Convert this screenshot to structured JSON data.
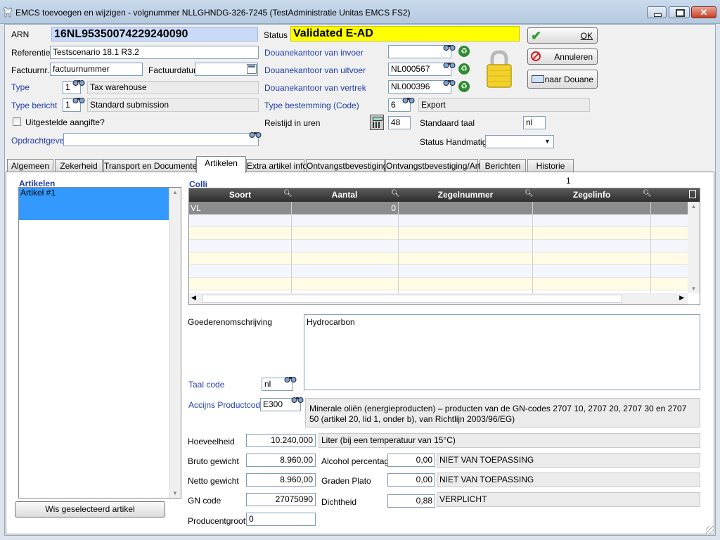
{
  "window": {
    "title": "EMCS toevoegen en wijzigen - volgnummer NLLGHNDG-326-7245 (TestAdministratie Unitas EMCS FS2)"
  },
  "header": {
    "arn_label": "ARN",
    "arn_value": "16NL95350074229240090",
    "status_label": "Status",
    "status_value": "Validated E-AD",
    "referentie_label": "Referentie",
    "referentie_value": "Testscenario 18.1 R3.2",
    "factuurnr_label": "Factuurnr.:",
    "factuurnr_value": "factuurnummer",
    "factuurdatum_label": "Factuurdatum",
    "factuurdatum_value": "",
    "type_label": "Type",
    "type_code": "1",
    "type_desc": "Tax warehouse",
    "type_bericht_label": "Type bericht",
    "type_bericht_code": "1",
    "type_bericht_desc": "Standard submission",
    "uitgestelde_label": "Uitgestelde aangifte?",
    "opdrachtgever_label": "Opdrachtgever",
    "opdrachtgever_value": "",
    "dk_invoer_label": "Douanekantoor van invoer",
    "dk_invoer_value": "",
    "dk_uitvoer_label": "Douanekantoor van uitvoer",
    "dk_uitvoer_value": "NL000567",
    "dk_vertrek_label": "Douanekantoor van vertrek",
    "dk_vertrek_value": "NL000396",
    "type_bestemming_label": "Type bestemming (Code)",
    "type_bestemming_code": "6",
    "type_bestemming_desc": "Export",
    "reistijd_label": "Reistijd in uren",
    "reistijd_value": "48",
    "standaard_taal_label": "Standaard taal",
    "standaard_taal_value": "nl",
    "status_handmatig_label": "Status Handmatig",
    "status_handmatig_value": ""
  },
  "buttons": {
    "ok": "OK",
    "annuleren": "Annuleren",
    "naar_douane": "naar Douane",
    "wis_artikel": "Wis geselecteerd artikel"
  },
  "tabs": [
    {
      "label": "Algemeen"
    },
    {
      "label": "Zekerheid"
    },
    {
      "label": "Transport en Documenten"
    },
    {
      "label": "Artikelen"
    },
    {
      "label": "Extra artikel info"
    },
    {
      "label": "Ontvangstbevestiging"
    },
    {
      "label": "Ontvangstbevestiging/Art."
    },
    {
      "label": "Berichten"
    },
    {
      "label": "Historie"
    }
  ],
  "artikelen": {
    "title": "Artikelen",
    "items": [
      "Artikel #1"
    ]
  },
  "colli": {
    "title": "Colli",
    "count": "1",
    "columns": [
      "Soort",
      "Aantal",
      "Zegelnummer",
      "Zegelinfo"
    ],
    "rows": [
      {
        "soort": "VL",
        "aantal": "0",
        "zegelnummer": "",
        "zegelinfo": ""
      }
    ]
  },
  "detail": {
    "goederen_label": "Goederenomschrijving",
    "goederen_value": "Hydrocarbon",
    "taalcode_label": "Taal code",
    "taalcode_value": "nl",
    "accijns_label": "Accijns Productcode",
    "accijns_code": "E300",
    "accijns_desc": "Minerale oliën (energieproducten) – producten van de GN-codes 2707 10, 2707 20, 2707 30 en 2707 50 (artikel 20, lid 1, onder b), van Richtlijn 2003/96/EG)",
    "hoeveelheid_label": "Hoeveelheid",
    "hoeveelheid_value": "10.240,000",
    "hoeveelheid_unit": "Liter (bij een temperatuur van 15°C)",
    "bruto_label": "Bruto gewicht",
    "bruto_value": "8.960,00",
    "netto_label": "Netto gewicht",
    "netto_value": "8.960,00",
    "gn_label": "GN code",
    "gn_value": "27075090",
    "producent_label": "Producentgrootte",
    "producent_value": "0",
    "alcohol_label": "Alcohol percentage",
    "alcohol_value": "0,00",
    "alcohol_note": "NIET VAN TOEPASSING",
    "plato_label": "Graden Plato",
    "plato_value": "0,00",
    "plato_note": "NIET VAN TOEPASSING",
    "dichtheid_label": "Dichtheid",
    "dichtheid_value": "0,88",
    "dichtheid_note": "VERPLICHT"
  },
  "colors": {
    "status_bg": "#ffff00",
    "arn_bg": "#c9daf8",
    "selection": "#3399ff",
    "label_blue": "#1f3dad"
  }
}
